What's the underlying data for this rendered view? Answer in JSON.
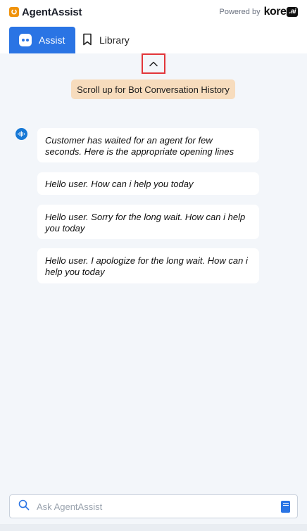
{
  "header": {
    "app_name": "AgentAssist",
    "powered_by": "Powered by",
    "vendor_word": "kore",
    "vendor_suffix": ".ai"
  },
  "tabs": [
    {
      "label": "Assist",
      "icon": "bot-icon",
      "active": true
    },
    {
      "label": "Library",
      "icon": "bookmark-icon",
      "active": false
    }
  ],
  "history": {
    "scroll_button_icon": "chevron-up-icon",
    "pill_text": "Scroll up for Bot Conversation History"
  },
  "conversation": {
    "avatar_icon": "audio-wave-icon",
    "messages": [
      "Customer  has waited for an agent for few seconds. Here is the appropriate opening lines",
      "Hello user. How can i help you today",
      "Hello user. Sorry for the long wait. How can i help you today",
      "Hello user. I apologize for the long wait. How can i help you today"
    ]
  },
  "search": {
    "placeholder": "Ask AgentAssist",
    "value": ""
  },
  "colors": {
    "accent": "#2a74e4",
    "brand_orange": "#f0930c",
    "highlight_border": "#e2353a",
    "pill_bg": "#f7dcbd",
    "page_bg": "#f3f6fa"
  }
}
